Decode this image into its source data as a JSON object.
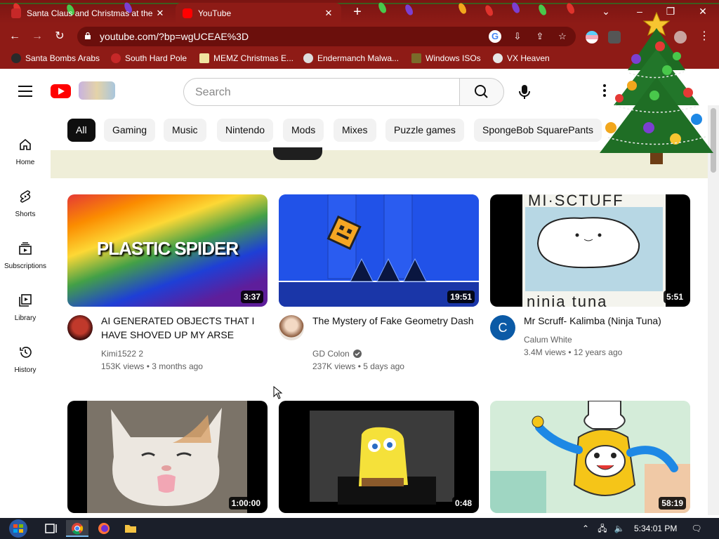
{
  "browser": {
    "tabs": [
      {
        "title": "Santa Claus and Christmas at the",
        "active": false
      },
      {
        "title": "YouTube",
        "active": true
      }
    ],
    "new_tab_label": "+",
    "url": "youtube.com/?bp=wgUCEAE%3D",
    "bookmarks": [
      {
        "label": "Santa Bombs Arabs",
        "icon": "santa-icon"
      },
      {
        "label": "South Hard Pole",
        "icon": "pole-icon"
      },
      {
        "label": "MEMZ Christmas E...",
        "icon": "memz-icon"
      },
      {
        "label": "Endermanch Malwa...",
        "icon": "endermanch-icon"
      },
      {
        "label": "Windows ISOs",
        "icon": "windows-isos-icon"
      },
      {
        "label": "VX Heaven",
        "icon": "vx-heaven-icon"
      }
    ],
    "accent": "#8e1b16"
  },
  "youtube": {
    "search_placeholder": "Search",
    "chips": [
      "All",
      "Gaming",
      "Music",
      "Nintendo",
      "Mods",
      "Mixes",
      "Puzzle games",
      "SpongeBob SquarePants"
    ],
    "sidebar": [
      {
        "label": "Home",
        "icon": "home-icon"
      },
      {
        "label": "Shorts",
        "icon": "shorts-icon"
      },
      {
        "label": "Subscriptions",
        "icon": "subscriptions-icon"
      },
      {
        "label": "Library",
        "icon": "library-icon"
      },
      {
        "label": "History",
        "icon": "history-icon"
      }
    ],
    "videos": [
      {
        "title": "AI GENERATED OBJECTS THAT I HAVE SHOVED UP MY ARSE",
        "channel": "Kimi1522 2",
        "verified": false,
        "views": "153K views",
        "age": "3 months ago",
        "duration": "3:37",
        "thumb_text": "PLASTIC SPIDER"
      },
      {
        "title": "The Mystery of Fake Geometry Dash",
        "channel": "GD Colon",
        "verified": true,
        "views": "237K views",
        "age": "5 days ago",
        "duration": "19:51"
      },
      {
        "title": "Mr Scruff- Kalimba (Ninja Tuna)",
        "channel": "Calum White",
        "verified": false,
        "views": "3.4M views",
        "age": "12 years ago",
        "duration": "5:51",
        "avatar_letter": "C"
      },
      {
        "duration": "1:00:00"
      },
      {
        "duration": "0:48"
      },
      {
        "duration": "58:19"
      }
    ]
  },
  "taskbar": {
    "time": "5:34:01 PM"
  }
}
